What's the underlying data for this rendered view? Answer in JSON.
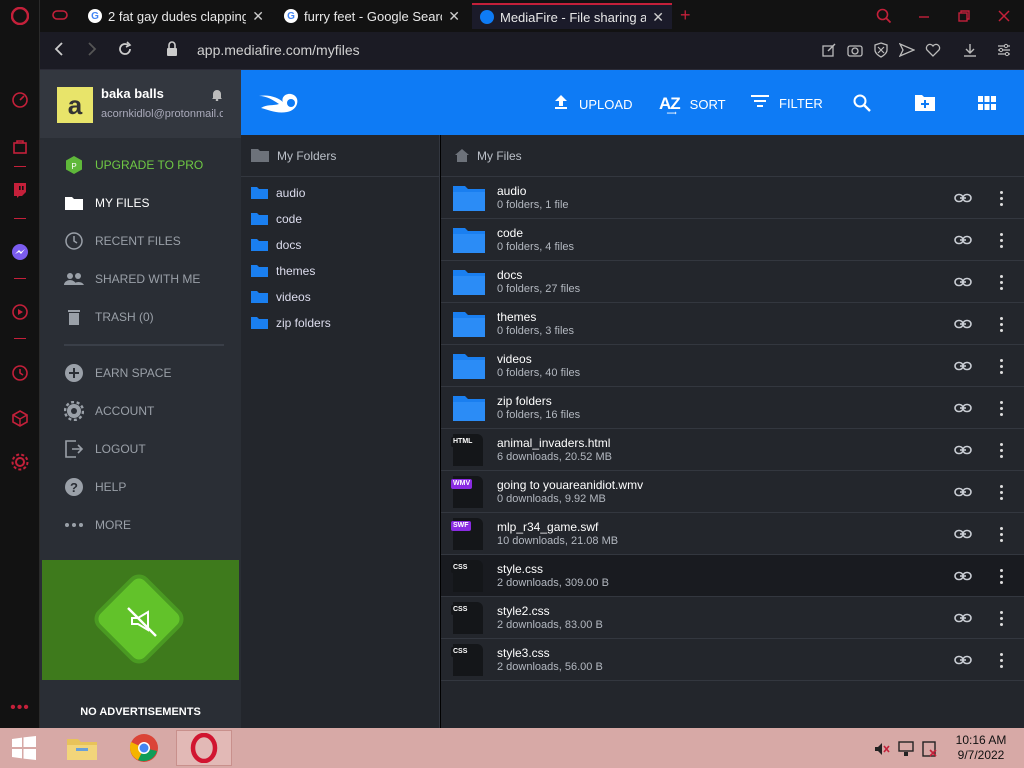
{
  "browser": {
    "tabs": [
      {
        "title": "2 fat gay dudes clapping c",
        "favicon": "youtube-like"
      },
      {
        "title": "furry feet - Google Search",
        "favicon": "google"
      },
      {
        "title": "MediaFire - File sharing and",
        "favicon": "mediafire"
      }
    ],
    "new_tab_glyph": "+",
    "close_glyph": "✕",
    "url": "app.mediafire.com/myfiles"
  },
  "account": {
    "avatar_letter": "a",
    "name": "baka balls",
    "email": "acornkidlol@protonmail.com"
  },
  "nav": {
    "upgrade": "UPGRADE TO PRO",
    "items": [
      {
        "label": "MY FILES",
        "icon": "folder-icon"
      },
      {
        "label": "RECENT FILES",
        "icon": "clock-icon"
      },
      {
        "label": "SHARED WITH ME",
        "icon": "people-icon"
      },
      {
        "label": "TRASH (0)",
        "icon": "trash-icon"
      }
    ],
    "secondary": [
      {
        "label": "EARN SPACE",
        "icon": "plus-circle-icon"
      },
      {
        "label": "ACCOUNT",
        "icon": "gear-icon"
      },
      {
        "label": "LOGOUT",
        "icon": "logout-icon"
      },
      {
        "label": "HELP",
        "icon": "help-icon"
      },
      {
        "label": "MORE",
        "icon": "more-icon"
      }
    ],
    "promo_text": "NO ADVERTISEMENTS"
  },
  "toolbar": {
    "upload": "UPLOAD",
    "sort": "SORT",
    "sort_icon_text": "A͢Z",
    "filter": "FILTER"
  },
  "folders_panel": {
    "title": "My Folders",
    "items": [
      "audio",
      "code",
      "docs",
      "themes",
      "videos",
      "zip folders"
    ]
  },
  "files_panel": {
    "title": "My Files",
    "rows": [
      {
        "name": "audio",
        "meta": "0 folders, 1 file",
        "kind": "folder"
      },
      {
        "name": "code",
        "meta": "0 folders, 4 files",
        "kind": "folder"
      },
      {
        "name": "docs",
        "meta": "0 folders, 27 files",
        "kind": "folder"
      },
      {
        "name": "themes",
        "meta": "0 folders, 3 files",
        "kind": "folder"
      },
      {
        "name": "videos",
        "meta": "0 folders, 40 files",
        "kind": "folder"
      },
      {
        "name": "zip folders",
        "meta": "0 folders, 16 files",
        "kind": "folder"
      },
      {
        "name": "animal_invaders.html",
        "meta": "6 downloads, 20.52 MB",
        "kind": "file",
        "tag": "HTML",
        "tag_color": "#141619"
      },
      {
        "name": "going to youareanidiot.wmv",
        "meta": "0 downloads, 9.92 MB",
        "kind": "file",
        "tag": "WMV",
        "tag_color": "#8a2be2"
      },
      {
        "name": "mlp_r34_game.swf",
        "meta": "10 downloads, 21.08 MB",
        "kind": "file",
        "tag": "SWF",
        "tag_color": "#8a2be2"
      },
      {
        "name": "style.css",
        "meta": "2 downloads, 309.00 B",
        "kind": "file",
        "tag": "CSS",
        "tag_color": "#141619"
      },
      {
        "name": "style2.css",
        "meta": "2 downloads, 83.00 B",
        "kind": "file",
        "tag": "CSS",
        "tag_color": "#141619"
      },
      {
        "name": "style3.css",
        "meta": "2 downloads, 56.00 B",
        "kind": "file",
        "tag": "CSS",
        "tag_color": "#141619"
      }
    ]
  },
  "taskbar": {
    "time": "10:16 AM",
    "date": "9/7/2022"
  },
  "colors": {
    "accent_blue": "#0e7bf5",
    "opera_red": "#c4203a",
    "pro_green": "#6fc844"
  }
}
